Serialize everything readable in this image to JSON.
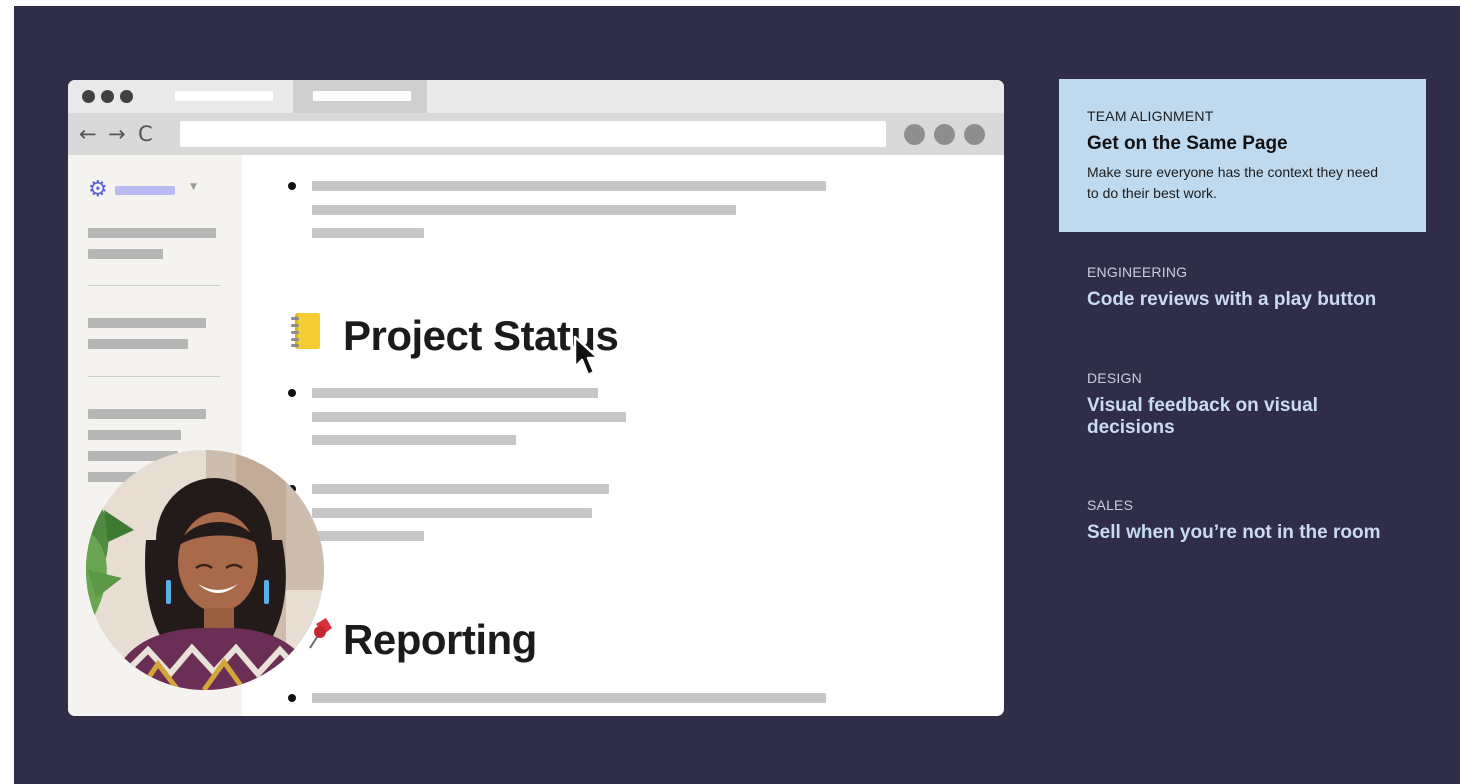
{
  "browser": {
    "nav": {
      "back": "←",
      "forward": "→",
      "reload": "C"
    }
  },
  "document": {
    "headings": [
      {
        "text": "Project Status",
        "icon": "notebook-icon"
      },
      {
        "text": "Reporting",
        "icon": "pushpin-icon"
      }
    ]
  },
  "features": [
    {
      "eyebrow": "TEAM ALIGNMENT",
      "title": "Get on the Same Page",
      "description": "Make sure everyone has the context they need to do their best work.",
      "active": true
    },
    {
      "eyebrow": "ENGINEERING",
      "title": "Code reviews with a play button",
      "active": false
    },
    {
      "eyebrow": "DESIGN",
      "title": "Visual feedback on visual decisions",
      "active": false
    },
    {
      "eyebrow": "SALES",
      "title": "Sell when you’re not in the room",
      "active": false
    }
  ],
  "colors": {
    "page_background": "#302d48",
    "active_card": "#bfd9ee",
    "inactive_title": "#c8dcf0",
    "accent_gear": "#5963d3"
  }
}
